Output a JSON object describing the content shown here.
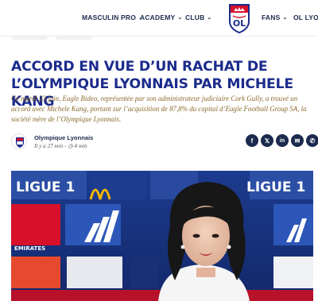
{
  "nav": {
    "items": [
      {
        "label": "MASCULIN PRO",
        "chevron": true
      },
      {
        "label": "ACADEMY",
        "chevron": true
      },
      {
        "label": "CLUB",
        "chevron": true
      },
      {
        "label": "FANS",
        "chevron": true
      },
      {
        "label": "OL LYON",
        "chevron": false
      }
    ],
    "logo_text": "OL"
  },
  "article": {
    "headline": "Accord en vue d’un rachat de l’Olympique Lyonnais par Michele Kang",
    "lead": "Ce mardi 23 juin, Eagle Bideo, représentée par son administrateur judiciaire Cork Gully, a trouvé un accord avec Michele Kang, portant sur l’acquisition de 87,8% du capital d’Eagle Football Group SA, la société mère de l’Olympique Lyonnais.",
    "author": {
      "name": "Olympique Lyonnais",
      "meta": "Il y a 27 min - ◷ 4 min"
    },
    "share": [
      {
        "icon": "facebook-icon",
        "glyph": "f"
      },
      {
        "icon": "x-twitter-icon",
        "glyph": "𝕏"
      },
      {
        "icon": "linkedin-icon",
        "glyph": "in"
      },
      {
        "icon": "email-icon",
        "glyph": "✉"
      },
      {
        "icon": "whatsapp-icon",
        "glyph": "✆"
      }
    ]
  },
  "hero": {
    "backdrop_words": [
      "LIGUE 1",
      "LIGUE 1",
      "EMIRATES"
    ],
    "colors": {
      "navy": "#1b2a4e",
      "ol_blue": "#1b2b8c",
      "ol_red": "#d7102b",
      "gold": "#8a6a2c"
    }
  }
}
